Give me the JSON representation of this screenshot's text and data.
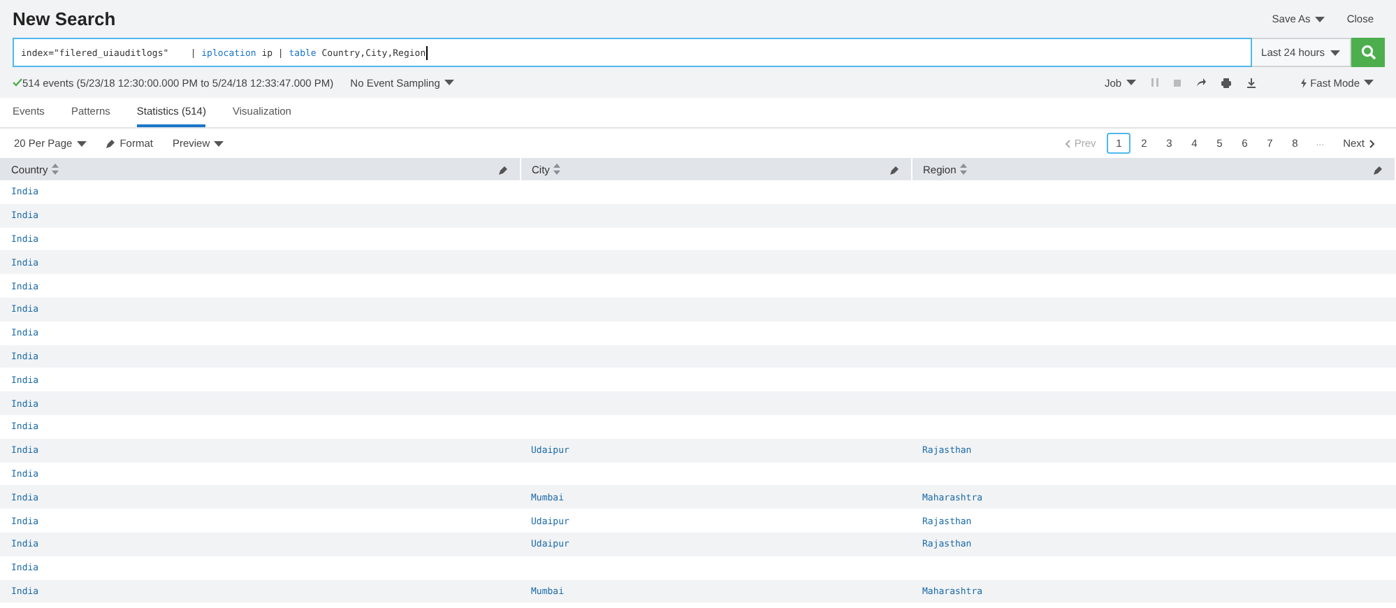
{
  "title": "New Search",
  "header_actions": [
    {
      "label": "Save As",
      "dropdown": true
    },
    {
      "label": "Close",
      "dropdown": false
    }
  ],
  "query": [
    {
      "kind": "text",
      "text": "index=\"filered_uiauditlogs\"    | "
    },
    {
      "kind": "command",
      "text": "iplocation"
    },
    {
      "kind": "text",
      "text": " ip | "
    },
    {
      "kind": "command",
      "text": "table"
    },
    {
      "kind": "text",
      "text": " Country,City,Region"
    }
  ],
  "time_range": "Last 24 hours",
  "status": {
    "events": "514 events (5/23/18 12:30:00.000 PM to 5/24/18 12:33:47.000 PM)",
    "sampling": "No Event Sampling"
  },
  "job_menu": "Job",
  "mode": "Fast Mode",
  "tabs": [
    {
      "label": "Events",
      "selected": false
    },
    {
      "label": "Patterns",
      "selected": false
    },
    {
      "label": "Statistics (514)",
      "selected": true
    },
    {
      "label": "Visualization",
      "selected": false
    }
  ],
  "toolbar": {
    "per_page": "20 Per Page",
    "format": "Format",
    "preview": "Preview"
  },
  "pagination": {
    "prev": "Prev",
    "prev_disabled": true,
    "pages": [
      {
        "label": "1",
        "selected": true
      },
      {
        "label": "2",
        "selected": false
      },
      {
        "label": "3",
        "selected": false
      },
      {
        "label": "4",
        "selected": false
      },
      {
        "label": "5",
        "selected": false
      },
      {
        "label": "6",
        "selected": false
      },
      {
        "label": "7",
        "selected": false
      },
      {
        "label": "8",
        "selected": false
      }
    ],
    "ellipsis": "...",
    "next": "Next"
  },
  "table": {
    "columns": [
      "Country",
      "City",
      "Region"
    ],
    "rows": [
      [
        "India",
        "",
        ""
      ],
      [
        "India",
        "",
        ""
      ],
      [
        "India",
        "",
        ""
      ],
      [
        "India",
        "",
        ""
      ],
      [
        "India",
        "",
        ""
      ],
      [
        "India",
        "",
        ""
      ],
      [
        "India",
        "",
        ""
      ],
      [
        "India",
        "",
        ""
      ],
      [
        "India",
        "",
        ""
      ],
      [
        "India",
        "",
        ""
      ],
      [
        "India",
        "",
        ""
      ],
      [
        "India",
        "Udaipur",
        "Rajasthan"
      ],
      [
        "India",
        "",
        ""
      ],
      [
        "India",
        "Mumbai",
        "Maharashtra"
      ],
      [
        "India",
        "Udaipur",
        "Rajasthan"
      ],
      [
        "India",
        "Udaipur",
        "Rajasthan"
      ],
      [
        "India",
        "",
        ""
      ],
      [
        "India",
        "Mumbai",
        "Maharashtra"
      ]
    ]
  }
}
